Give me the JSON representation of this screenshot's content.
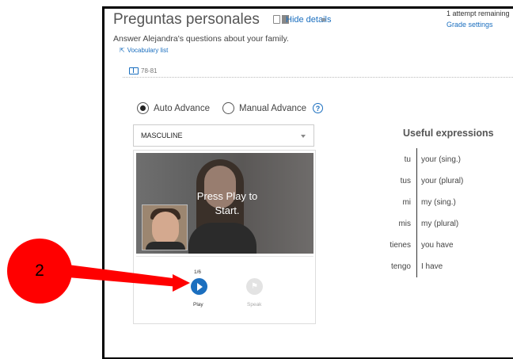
{
  "header": {
    "title": "Preguntas personales",
    "hide_details": "Hide details",
    "attempts": "1 attempt remaining",
    "grade_settings": "Grade settings"
  },
  "activity": {
    "instruction": "Answer Alejandra's questions about your family.",
    "vocab_link": "Vocabulary list",
    "book_pages": "78-81"
  },
  "mode": {
    "auto_label": "Auto Advance",
    "manual_label": "Manual Advance",
    "selected": "Auto Advance"
  },
  "voice_select": {
    "value": "MASCULINE"
  },
  "player": {
    "overlay_line1": "Press Play to",
    "overlay_line2": "Start.",
    "counter": "1/6",
    "play_label": "Play",
    "speak_label": "Speak"
  },
  "useful_expressions": {
    "title": "Useful expressions",
    "items": [
      {
        "es": "tu",
        "en": "your (sing.)"
      },
      {
        "es": "tus",
        "en": "your (plural)"
      },
      {
        "es": "mi",
        "en": "my (sing.)"
      },
      {
        "es": "mis",
        "en": "my (plural)"
      },
      {
        "es": "tienes",
        "en": "you have"
      },
      {
        "es": "tengo",
        "en": "I have"
      }
    ]
  },
  "annotation": {
    "number": "2",
    "badge_color": "#ff0000"
  },
  "colors": {
    "link": "#1b6fbf",
    "play_button": "#1b6fbf"
  },
  "icons": [
    "vocab-arrow-icon",
    "book-icon",
    "help-icon",
    "caret-down-icon",
    "play-icon",
    "speak-icon",
    "print-icon"
  ]
}
